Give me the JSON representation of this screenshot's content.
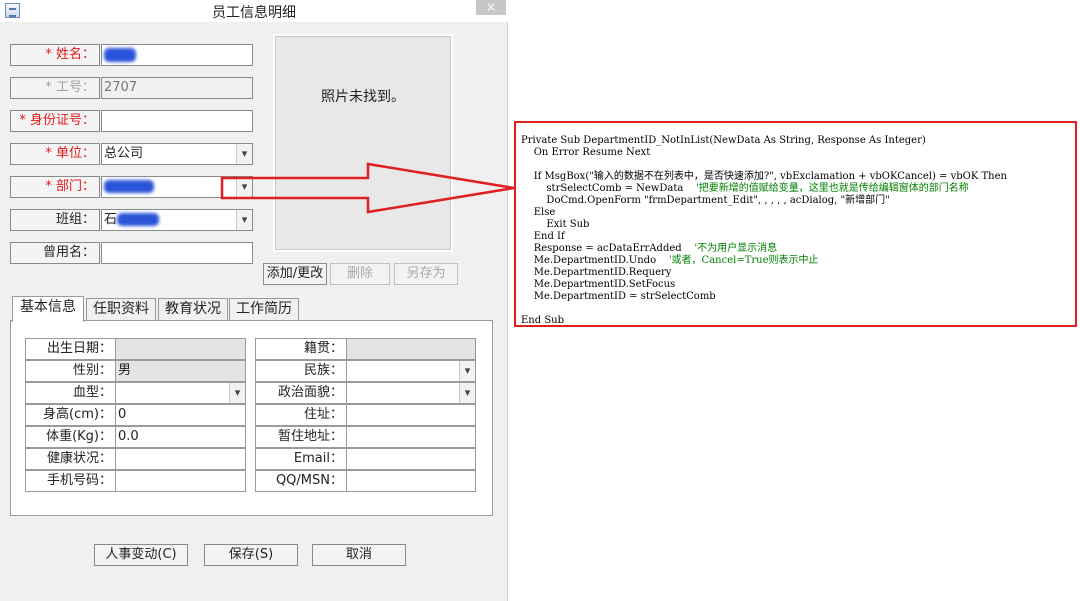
{
  "window": {
    "title": "员工信息明细",
    "close_label": "×"
  },
  "form": {
    "name_label": "* 姓名：",
    "id_label": "* 工号：",
    "id_value": "2707",
    "idcard_label": "* 身份证号：",
    "unit_label": "* 单位：",
    "unit_value": "总公司",
    "dept_label": "* 部门：",
    "team_label": "班组：",
    "alias_label": "曾用名：",
    "team_value_prefix": "石"
  },
  "photo": {
    "text": "照片未找到。"
  },
  "photo_buttons": {
    "add_edit": "添加/更改",
    "delete": "删除",
    "save_as": "另存为"
  },
  "tabs": [
    {
      "label": "基本信息"
    },
    {
      "label": "任职资料"
    },
    {
      "label": "教育状况"
    },
    {
      "label": "工作简历"
    }
  ],
  "basic": {
    "left": [
      {
        "label": "出生日期：",
        "value": ""
      },
      {
        "label": "性别：",
        "value": "男"
      },
      {
        "label": "血型：",
        "value": ""
      },
      {
        "label": "身高(cm)：",
        "value": "0"
      },
      {
        "label": "体重(Kg)：",
        "value": "0.0"
      },
      {
        "label": "健康状况：",
        "value": ""
      },
      {
        "label": "手机号码：",
        "value": ""
      }
    ],
    "right": [
      {
        "label": "籍贯：",
        "value": ""
      },
      {
        "label": "民族：",
        "value": ""
      },
      {
        "label": "政治面貌：",
        "value": ""
      },
      {
        "label": "住址：",
        "value": ""
      },
      {
        "label": "暂住地址：",
        "value": ""
      },
      {
        "label": "Email：",
        "value": ""
      },
      {
        "label": "QQ/MSN：",
        "value": ""
      }
    ]
  },
  "actions": {
    "hr_change": "人事变动(C)",
    "save": "保存(S)",
    "cancel": "取消"
  },
  "icons": {
    "dropdown": "▾"
  },
  "code": {
    "l01": "Private Sub DepartmentID_NotInList(NewData As String, Response As Integer)",
    "l02": "    On Error Resume Next",
    "l03": "",
    "l04": "    If MsgBox(\"输入的数据不在列表中，是否快速添加?\", vbExclamation + vbOKCancel) = vbOK Then",
    "l05a": "        strSelectComb = NewData    ",
    "l05b": "'把要新增的值赋给变量，这里也就是传给编辑窗体的部门名称",
    "l06": "        DoCmd.OpenForm \"frmDepartment_Edit\", , , , , acDialog, \"新增部门\"",
    "l07": "    Else",
    "l08": "        Exit Sub",
    "l09": "    End If",
    "l10a": "    Response = acDataErrAdded    ",
    "l10b": "'不为用户显示消息",
    "l11a": "    Me.DepartmentID.Undo    ",
    "l11b": "'或者，Cancel=True则表示中止",
    "l12": "    Me.DepartmentID.Requery",
    "l13": "    Me.DepartmentID.SetFocus",
    "l14": "    Me.DepartmentID = strSelectComb",
    "l15": "",
    "l16": "End Sub"
  },
  "colors": {
    "required": "#e01a1a",
    "callout": "#e02020",
    "comment": "#008000"
  }
}
